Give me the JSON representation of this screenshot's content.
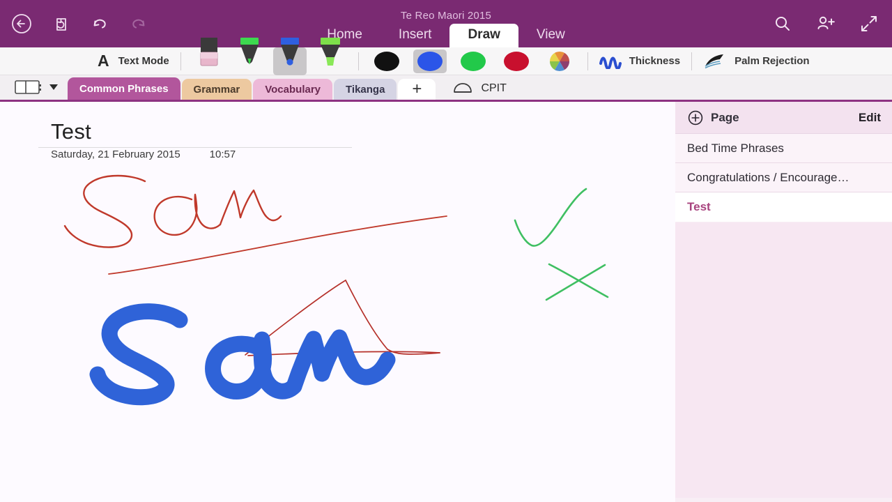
{
  "window": {
    "document_title": "Te Reo Maori 2015",
    "accent_color": "#7a2a72",
    "left_icons": [
      {
        "name": "back-icon",
        "label": "Back"
      },
      {
        "name": "sync-icon",
        "label": "Sync"
      },
      {
        "name": "undo-icon",
        "label": "Undo"
      },
      {
        "name": "redo-icon",
        "label": "Redo"
      }
    ],
    "right_icons": [
      {
        "name": "search-icon",
        "label": "Search"
      },
      {
        "name": "share-person-icon",
        "label": "Share"
      },
      {
        "name": "fullscreen-icon",
        "label": "Full Screen"
      }
    ]
  },
  "ribbon": {
    "tabs": [
      {
        "label": "Home",
        "active": false
      },
      {
        "label": "Insert",
        "active": false
      },
      {
        "label": "Draw",
        "active": true
      },
      {
        "label": "View",
        "active": false
      }
    ],
    "active_tab": "Draw"
  },
  "drawbar": {
    "text_mode_label": "Text Mode",
    "text_mode_glyph": "A",
    "pens": [
      {
        "name": "eraser-tool",
        "type": "eraser",
        "color": "#eab9cd",
        "selected": false
      },
      {
        "name": "pen-green-tool",
        "type": "pen",
        "color": "#3dd94f",
        "selected": false
      },
      {
        "name": "pen-blue-tool",
        "type": "pen",
        "color": "#2f5fe0",
        "selected": true
      },
      {
        "name": "highlighter-green-tool",
        "type": "highlighter",
        "color": "#7ee04a",
        "selected": false
      }
    ],
    "colors": [
      {
        "name": "color-black",
        "hex": "#111111",
        "selected": false
      },
      {
        "name": "color-blue",
        "hex": "#2b55e8",
        "selected": true
      },
      {
        "name": "color-green",
        "hex": "#22c94a",
        "selected": false
      },
      {
        "name": "color-red",
        "hex": "#c8102e",
        "selected": false
      },
      {
        "name": "color-wheel",
        "hex": "multicolor",
        "selected": false
      }
    ],
    "thickness_label": "Thickness",
    "palm_rejection_label": "Palm Rejection"
  },
  "sections": {
    "notebook_button_label": "",
    "tabs": [
      {
        "label": "Common Phrases",
        "bg": "#b2569c",
        "fg": "#ffffff",
        "active": true
      },
      {
        "label": "Grammar",
        "bg": "#edc9a0",
        "fg": "#4a3a2a",
        "active": false
      },
      {
        "label": "Vocabulary",
        "bg": "#edb9d8",
        "fg": "#6b2a52",
        "active": false
      },
      {
        "label": "Tikanga",
        "bg": "#d5d4e4",
        "fg": "#343349",
        "active": false
      }
    ],
    "add_tab_label": "+",
    "notebook_name": "CPIT"
  },
  "page": {
    "title": "Test",
    "date": "Saturday, 21 February 2015",
    "time": "10:57",
    "ink_strokes": [
      {
        "name": "handwriting-sam-red",
        "text": "Sam",
        "color": "#c0392b",
        "style": "thin-pen"
      },
      {
        "name": "underline-red",
        "color": "#c0392b",
        "style": "thin-pen"
      },
      {
        "name": "triangle-red",
        "color": "#c0392b",
        "style": "thin-pen"
      },
      {
        "name": "handwriting-sam-blue",
        "text": "Sam",
        "color": "#2f63d8",
        "style": "thick-pen"
      },
      {
        "name": "checkmark-green",
        "color": "#3fbf62",
        "style": "thin-pen"
      },
      {
        "name": "cross-green",
        "color": "#3fbf62",
        "style": "thin-pen"
      }
    ]
  },
  "sidebar": {
    "header": {
      "add_page_label": "Page",
      "edit_label": "Edit"
    },
    "pages": [
      {
        "label": "Bed Time Phrases",
        "active": false
      },
      {
        "label": "Congratulations / Encourage…",
        "active": false
      },
      {
        "label": "Test",
        "active": true
      }
    ]
  }
}
